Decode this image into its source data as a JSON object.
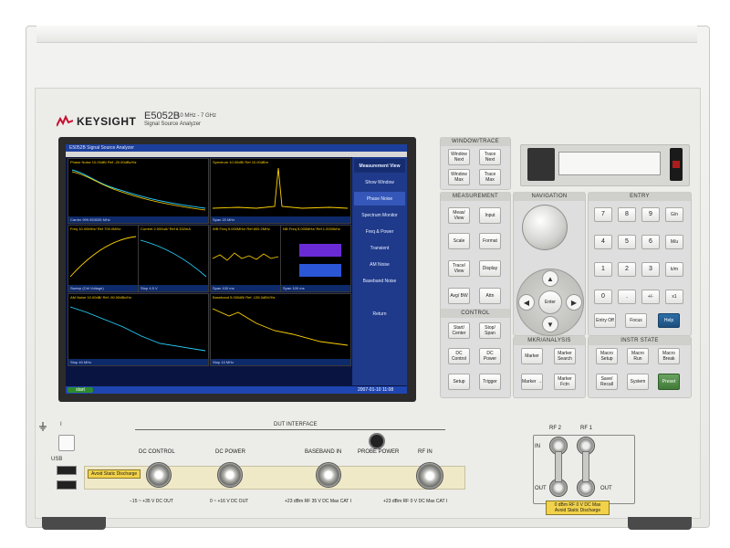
{
  "brand": {
    "name": "KEYSIGHT",
    "model": "E5052B",
    "freq_range": "10 MHz - 7 GHz",
    "description": "Signal Source Analyzer"
  },
  "screen": {
    "window_title": "E5052B Signal Source Analyzer",
    "softkeys": [
      "Measurement View",
      "Show Window",
      "Phase Noise",
      "Spectrum Monitor",
      "Freq & Power",
      "Transient",
      "AM Noise",
      "Baseband Noise",
      "Return"
    ],
    "selected_softkey_index": 2,
    "start_label": "start",
    "clock": "2007-01-10 11:08",
    "traces": [
      {
        "title": "Phase Noise 10.00dB/ Ref -20.00dBc/Hz",
        "footer": "Carrier 999.953035 MHz"
      },
      {
        "title": "Spectrum 10.00dB/ Ref 10.00dBm",
        "footer": "Span 20 MHz"
      },
      {
        "title": "Freq 10.00MHz/ Ref 700.0MHz",
        "footer": "Sweep (Ctrl Voltage)"
      },
      {
        "title": "Current 2.000uA/ Ref 8.332mA",
        "footer": "Stop 4.5 V"
      },
      {
        "title": "WB Freq 5.000MHz/ Ref 800.2MHz",
        "footer": "Span 100 ms"
      },
      {
        "title": "NB Freq 5.000MHz/ Ref 1.0000kHz",
        "footer": "Span 100 ms"
      },
      {
        "title": "AM Noise 10.00dB/ Ref -90.00dBc/Hz",
        "footer": "Stop 40 MHz"
      },
      {
        "title": "Baseband 5.000dB/ Ref -135.0dBV/Hz",
        "footer": "Stop 10 MHz"
      }
    ]
  },
  "groups": {
    "window_trace": {
      "title": "WINDOW/TRACE",
      "keys": [
        "Window Next",
        "Trace Next",
        "Window Max",
        "Trace Max"
      ]
    },
    "measurement": {
      "title": "MEASUREMENT",
      "keys": [
        "Meas/ View",
        "Input",
        "Scale",
        "Format",
        "Trace/ View",
        "Display",
        "Avg/ BW",
        "Attn"
      ]
    },
    "control": {
      "title": "CONTROL",
      "keys": [
        "Start/ Center",
        "Stop/ Span",
        "DC Control",
        "DC Power",
        "Setup",
        "Trigger"
      ]
    },
    "navigation": {
      "title": "NAVIGATION",
      "enter": "Enter"
    },
    "mkr_analysis": {
      "title": "MKR/ANALYSIS",
      "keys": [
        "Marker",
        "Marker Search",
        "Marker →",
        "Marker Fctn"
      ]
    },
    "entry": {
      "title": "ENTRY",
      "keys": [
        "7",
        "8",
        "9",
        "G/n",
        "4",
        "5",
        "6",
        "M/u",
        "1",
        "2",
        "3",
        "k/m",
        "0",
        ".",
        "+/-",
        "x1",
        "Entry Off",
        "Focus",
        "Help"
      ]
    },
    "instr_state": {
      "title": "INSTR STATE",
      "keys": [
        "Macro Setup",
        "Macro Run",
        "Macro Break",
        "Save/ Recall",
        "System",
        "Preset"
      ]
    }
  },
  "bottom": {
    "dout_title": "DUT INTERFACE",
    "usb_label": "USB",
    "standby_label": "I",
    "static_warning": "Avoid Static Discharge",
    "connectors": [
      {
        "label": "DC CONTROL",
        "spec": "−15 ~ +35 V DC OUT"
      },
      {
        "label": "DC POWER",
        "spec": "0 ~ +16 V DC OUT"
      },
      {
        "label": "BASEBAND IN",
        "spec": "+23 dBm RF  35 V DC  Max  CAT I"
      },
      {
        "label": "PROBE POWER",
        "spec": ""
      },
      {
        "label": "RF IN",
        "spec": "+23 dBm RF  0 V DC  Max  CAT I"
      }
    ],
    "rf_ports": {
      "rf2": "RF 2",
      "rf1": "RF 1",
      "in": "IN",
      "out": "OUT",
      "warning": "0 dBm RF  0 V DC  Max  Avoid Static Discharge"
    }
  },
  "colors": {
    "chassis": "#ecece9",
    "screen_bg": "#0a1440",
    "softkey_panel": "#1f3a8a",
    "help_key": "#2c6fa8",
    "preset_key": "#4f8a44",
    "warning_yellow": "#f2d24a"
  }
}
